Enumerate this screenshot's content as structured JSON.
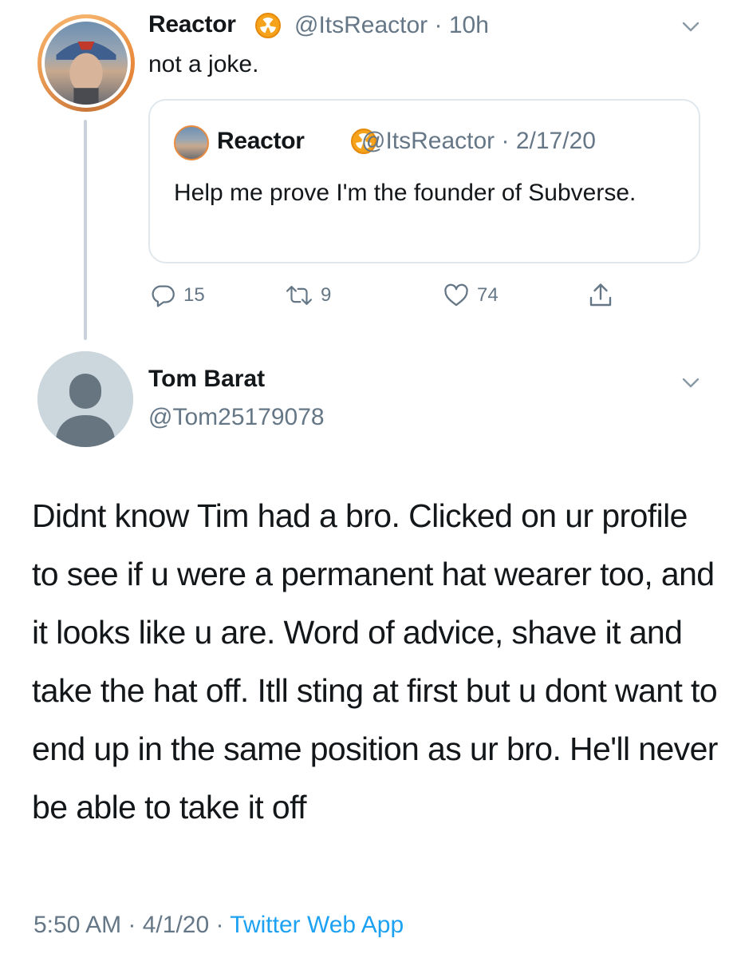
{
  "parent_tweet": {
    "author_name": "Reactor",
    "handle": "@ItsReactor",
    "time": "10h",
    "text": "not a joke.",
    "badge_icon": "radioactive-icon",
    "quoted_tweet": {
      "author_name": "Reactor",
      "handle": "@ItsReactor",
      "date": "2/17/20",
      "text": "Help me prove I'm the founder of Subverse."
    },
    "actions": {
      "replies": "15",
      "retweets": "9",
      "likes": "74"
    }
  },
  "reply_tweet": {
    "author_name": "Tom Barat",
    "handle": "@Tom25179078",
    "text": "Didnt know Tim had a bro. Clicked on ur profile to see if u were a permanent hat wearer too, and it looks like u are. Word of advice, shave it and take the hat off. Itll sting at first but u dont want to end up in the same position as ur bro. He'll never be able to take it off",
    "time": "5:50 AM",
    "date": "4/1/20",
    "source": "Twitter Web App"
  },
  "colors": {
    "text": "#14171a",
    "secondary": "#657786",
    "link": "#1da1f2",
    "border": "#e1e8ed",
    "badge": "#f7a21b"
  }
}
